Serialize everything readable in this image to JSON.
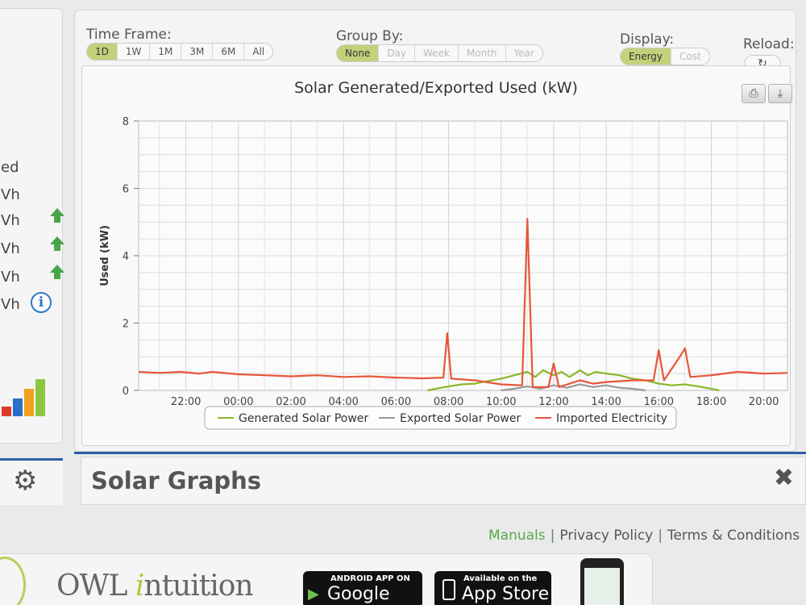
{
  "left_panel": {
    "rows": [
      "ed",
      "Vh",
      "Vh",
      "Vh",
      "Vh",
      "Vh"
    ],
    "signal_colors": [
      "#e03a2a",
      "#2a6fc8",
      "#f0a020",
      "#8cc63f"
    ]
  },
  "controls": {
    "time_frame": {
      "label": "Time Frame:",
      "options": [
        "1D",
        "1W",
        "1M",
        "3M",
        "6M",
        "All"
      ],
      "active": "1D"
    },
    "group_by": {
      "label": "Group By:",
      "options": [
        "None",
        "Day",
        "Week",
        "Month",
        "Year"
      ],
      "active": "None"
    },
    "display": {
      "label": "Display:",
      "options": [
        "Energy",
        "Cost"
      ],
      "active": "Energy"
    },
    "reload": {
      "label": "Reload:",
      "icon": "refresh-icon",
      "glyph": "↻"
    }
  },
  "toolbar": {
    "print_glyph": "⎙",
    "download_glyph": "⤓"
  },
  "section": {
    "title": "Solar Graphs",
    "close_glyph": "✖"
  },
  "footer": {
    "manuals": "Manuals",
    "privacy": "Privacy Policy",
    "terms": "Terms & Conditions",
    "sep": "|"
  },
  "brand": {
    "owl_prefix": "OWL",
    "owl_suffix": "ntuition",
    "owl_i": "i"
  },
  "badges": {
    "google": {
      "small": "ANDROID APP ON",
      "big": "Google play"
    },
    "apple": {
      "small": "Available on the",
      "big": "App Store"
    }
  },
  "colors": {
    "generated": "#8ab82a",
    "exported": "#9a9a9a",
    "imported": "#e8553a",
    "accent": "#c4d07a",
    "blue": "#2d5da8"
  },
  "chart_data": {
    "type": "line",
    "title": "Solar Generated/Exported Used (kW)",
    "ylabel": "Used (kW)",
    "xlabel": "",
    "ylim": [
      0,
      8
    ],
    "yticks": [
      0,
      2,
      4,
      6,
      8
    ],
    "xlim": [
      20.2,
      44.9
    ],
    "xticks": [
      {
        "v": 22,
        "label": "22:00"
      },
      {
        "v": 24,
        "label": "00:00"
      },
      {
        "v": 26,
        "label": "02:00"
      },
      {
        "v": 28,
        "label": "04:00"
      },
      {
        "v": 30,
        "label": "06:00"
      },
      {
        "v": 32,
        "label": "08:00"
      },
      {
        "v": 34,
        "label": "10:00"
      },
      {
        "v": 36,
        "label": "12:00"
      },
      {
        "v": 38,
        "label": "14:00"
      },
      {
        "v": 40,
        "label": "16:00"
      },
      {
        "v": 42,
        "label": "18:00"
      },
      {
        "v": 44,
        "label": "20:00"
      }
    ],
    "grid": true,
    "legend_position": "bottom",
    "series": [
      {
        "name": "Generated Solar Power",
        "color": "#8ab82a",
        "points": [
          [
            31.2,
            0
          ],
          [
            31.5,
            0.05
          ],
          [
            32,
            0.12
          ],
          [
            32.5,
            0.18
          ],
          [
            33,
            0.2
          ],
          [
            33.5,
            0.28
          ],
          [
            34,
            0.35
          ],
          [
            34.5,
            0.45
          ],
          [
            35,
            0.55
          ],
          [
            35.3,
            0.4
          ],
          [
            35.6,
            0.6
          ],
          [
            36,
            0.45
          ],
          [
            36.3,
            0.55
          ],
          [
            36.6,
            0.4
          ],
          [
            37,
            0.6
          ],
          [
            37.3,
            0.45
          ],
          [
            37.6,
            0.55
          ],
          [
            38,
            0.5
          ],
          [
            38.5,
            0.45
          ],
          [
            39,
            0.35
          ],
          [
            39.5,
            0.3
          ],
          [
            40,
            0.2
          ],
          [
            40.5,
            0.15
          ],
          [
            41,
            0.18
          ],
          [
            41.5,
            0.12
          ],
          [
            42,
            0.05
          ],
          [
            42.3,
            0
          ]
        ]
      },
      {
        "name": "Exported Solar Power",
        "color": "#9a9a9a",
        "points": [
          [
            34,
            0
          ],
          [
            34.5,
            0.05
          ],
          [
            35,
            0.12
          ],
          [
            35.5,
            0.05
          ],
          [
            36,
            0.15
          ],
          [
            36.5,
            0.08
          ],
          [
            37,
            0.18
          ],
          [
            37.5,
            0.1
          ],
          [
            38,
            0.15
          ],
          [
            38.5,
            0.08
          ],
          [
            39,
            0.05
          ],
          [
            39.5,
            0
          ]
        ]
      },
      {
        "name": "Imported Electricity",
        "color": "#e8553a",
        "points": [
          [
            20.2,
            0.55
          ],
          [
            21,
            0.52
          ],
          [
            21.8,
            0.55
          ],
          [
            22.5,
            0.5
          ],
          [
            23,
            0.55
          ],
          [
            24,
            0.48
          ],
          [
            25,
            0.45
          ],
          [
            26,
            0.42
          ],
          [
            27,
            0.45
          ],
          [
            28,
            0.4
          ],
          [
            29,
            0.42
          ],
          [
            30,
            0.38
          ],
          [
            31,
            0.36
          ],
          [
            31.8,
            0.38
          ],
          [
            31.95,
            1.7
          ],
          [
            32.1,
            0.35
          ],
          [
            33,
            0.3
          ],
          [
            34,
            0.18
          ],
          [
            34.8,
            0.15
          ],
          [
            35.0,
            5.1
          ],
          [
            35.2,
            0.1
          ],
          [
            35.8,
            0.1
          ],
          [
            36,
            0.8
          ],
          [
            36.2,
            0.1
          ],
          [
            37,
            0.3
          ],
          [
            37.5,
            0.2
          ],
          [
            38,
            0.25
          ],
          [
            39,
            0.3
          ],
          [
            39.8,
            0.3
          ],
          [
            40,
            1.2
          ],
          [
            40.2,
            0.3
          ],
          [
            40.8,
            1.0
          ],
          [
            41,
            1.25
          ],
          [
            41.2,
            0.4
          ],
          [
            42,
            0.45
          ],
          [
            43,
            0.55
          ],
          [
            44,
            0.5
          ],
          [
            44.9,
            0.52
          ]
        ]
      }
    ]
  }
}
